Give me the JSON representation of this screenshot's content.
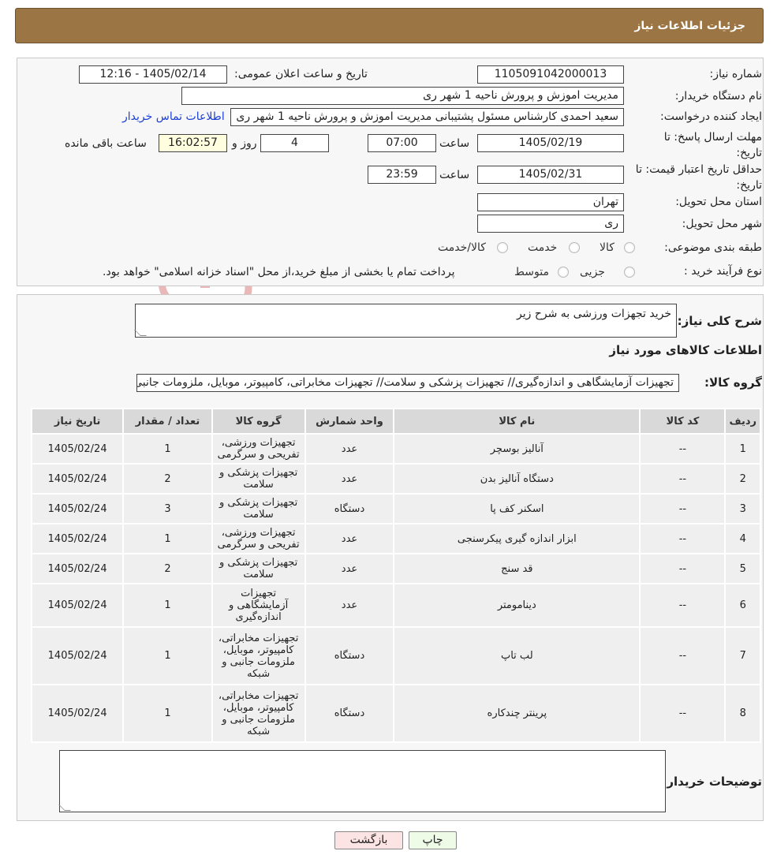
{
  "page": {
    "title": "جزئیات اطلاعات نیاز"
  },
  "header": {
    "need_number_label": "شماره نیاز:",
    "need_number": "1105091042000013",
    "announce_label": "تاریخ و ساعت اعلان عمومی:",
    "announce_value": "1405/02/14 - 12:16",
    "buyer_org_label": "نام دستگاه خریدار:",
    "buyer_org": "مدیریت اموزش و پرورش ناحیه 1 شهر ری",
    "requester_label": "ایجاد کننده درخواست:",
    "requester": "سعید احمدی کارشناس مسئول پشتیبانی مدیریت اموزش و پرورش ناحیه 1 شهر ری",
    "contact_link": "اطلاعات تماس خریدار",
    "reply_deadline_label": "مهلت ارسال پاسخ: تا تاریخ:",
    "reply_date": "1405/02/19",
    "time_label": "ساعت",
    "reply_time": "07:00",
    "days_value": "4",
    "days_label": "روز و",
    "remaining_time": "16:02:57",
    "remaining_label": "ساعت باقی مانده",
    "price_validity_label": "حداقل تاریخ اعتبار قیمت: تا تاریخ:",
    "price_date": "1405/02/31",
    "price_time": "23:59",
    "province_label": "استان محل تحویل:",
    "province": "تهران",
    "city_label": "شهر محل تحویل:",
    "city": "ری",
    "category_label": "طبقه بندی موضوعی:",
    "category_options": [
      "کالا",
      "خدمت",
      "کالا/خدمت"
    ],
    "process_label": "نوع فرآیند خرید :",
    "process_options": [
      "جزیی",
      "متوسط"
    ],
    "payment_note": "پرداخت تمام یا بخشی از مبلغ خرید،از محل \"اسناد خزانه اسلامی\" خواهد بود."
  },
  "details": {
    "summary_label": "شرح کلی نیاز:",
    "summary_value": "خرید تجهزات ورزشی به شرح زیر",
    "goods_info_title": "اطلاعات کالاهای مورد نیاز",
    "goods_group_label": "گروه کالا:",
    "goods_group_value": "تجهیزات آزمایشگاهی و اندازه‌گیری// تجهیزات پزشکی و سلامت// تجهیزات مخابراتی، کامپیوتر، موبایل، ملزومات جانبی و شبکه",
    "table": {
      "columns": [
        "ردیف",
        "کد کالا",
        "نام کالا",
        "واحد شمارش",
        "گروه کالا",
        "تعداد / مقدار",
        "تاریخ نیاز"
      ],
      "rows": [
        [
          "1",
          "--",
          "آنالیز بوسچر",
          "عدد",
          "تجهیزات ورزشی، تفریحی و سرگرمی",
          "1",
          "1405/02/24"
        ],
        [
          "2",
          "--",
          "دستگاه آنالیز بدن",
          "عدد",
          "تجهیزات پزشکی و سلامت",
          "2",
          "1405/02/24"
        ],
        [
          "3",
          "--",
          "اسکنر کف پا",
          "دستگاه",
          "تجهیزات پزشکی و سلامت",
          "3",
          "1405/02/24"
        ],
        [
          "4",
          "--",
          "ابزار اندازه گیری پیکرسنجی",
          "عدد",
          "تجهیزات ورزشی، تفریحی و سرگرمی",
          "1",
          "1405/02/24"
        ],
        [
          "5",
          "--",
          "قد سنج",
          "عدد",
          "تجهیزات پزشکی و سلامت",
          "2",
          "1405/02/24"
        ],
        [
          "6",
          "--",
          "دینامومتر",
          "عدد",
          "تجهیزات آزمایشگاهی و اندازه‌گیری",
          "1",
          "1405/02/24"
        ],
        [
          "7",
          "--",
          "لب تاپ",
          "دستگاه",
          "تجهیزات مخابراتی، کامپیوتر، موبایل، ملزومات جانبی و شبکه",
          "1",
          "1405/02/24"
        ],
        [
          "8",
          "--",
          "پرینتر چندکاره",
          "دستگاه",
          "تجهیزات مخابراتی، کامپیوتر، موبایل، ملزومات جانبی و شبکه",
          "1",
          "1405/02/24"
        ]
      ]
    },
    "buyer_notes_label": "توضیحات خریدار:",
    "buyer_notes_value": ""
  },
  "actions": {
    "print": "چاپ",
    "back": "بازگشت"
  },
  "watermark": {
    "text": "AriaTender.neT",
    "color": "#e6b3b3"
  }
}
